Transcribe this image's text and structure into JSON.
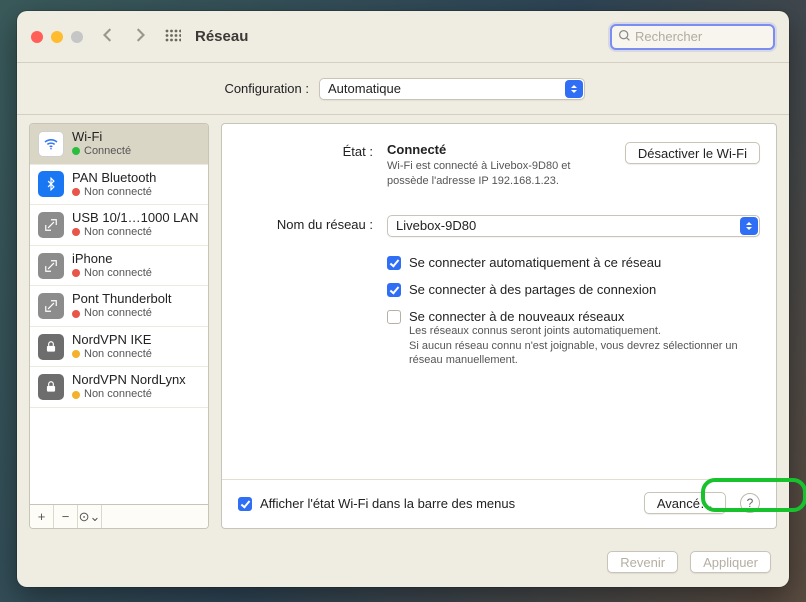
{
  "title": "Réseau",
  "search_placeholder": "Rechercher",
  "config_label": "Configuration :",
  "config_value": "Automatique",
  "sidebar": [
    {
      "name": "Wi-Fi",
      "status": "Connecté",
      "dot": "g",
      "icon": "wifi",
      "sel": true
    },
    {
      "name": "PAN Bluetooth",
      "status": "Non connecté",
      "dot": "r",
      "icon": "bt"
    },
    {
      "name": "USB 10/1…1000 LAN",
      "status": "Non connecté",
      "dot": "r",
      "icon": "gen"
    },
    {
      "name": "iPhone",
      "status": "Non connecté",
      "dot": "r",
      "icon": "gen"
    },
    {
      "name": "Pont Thunderbolt",
      "status": "Non connecté",
      "dot": "r",
      "icon": "gen"
    },
    {
      "name": "NordVPN IKE",
      "status": "Non connecté",
      "dot": "y",
      "icon": "lock"
    },
    {
      "name": "NordVPN NordLynx",
      "status": "Non connecté",
      "dot": "y",
      "icon": "lock"
    }
  ],
  "side_tools": {
    "add": "+",
    "remove": "−",
    "more": "⊙⌄"
  },
  "status_label": "État :",
  "status_value": "Connecté",
  "disable_btn": "Désactiver le Wi-Fi",
  "status_sub": "Wi-Fi est connecté à Livebox-9D80 et possède l'adresse IP 192.168.1.23.",
  "network_label": "Nom du réseau :",
  "network_value": "Livebox-9D80",
  "opt_auto": "Se connecter automatiquement à ce réseau",
  "opt_share": "Se connecter à des partages de connexion",
  "opt_new": "Se connecter à de nouveaux réseaux",
  "opt_new_hint": "Les réseaux connus seront joints automatiquement.\nSi aucun réseau connu n'est joignable, vous devrez sélectionner un réseau manuellement.",
  "show_menu": "Afficher l'état Wi-Fi dans la barre des menus",
  "advanced": "Avancé…",
  "revert": "Revenir",
  "apply": "Appliquer"
}
